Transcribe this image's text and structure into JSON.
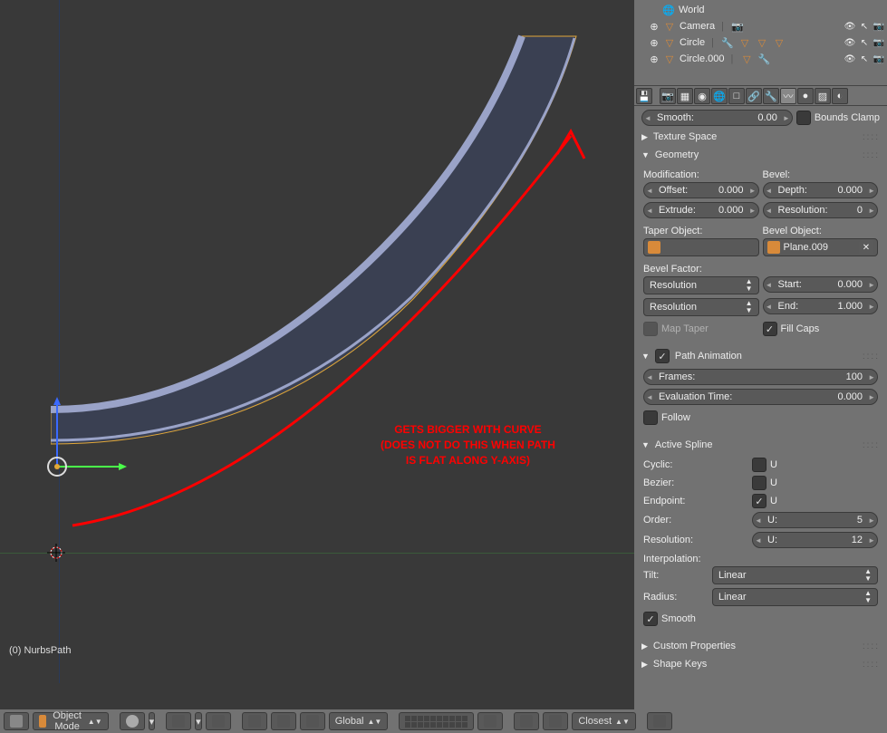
{
  "viewport": {
    "selection_label": "(0)  NurbsPath",
    "annotation_line1": "GETS BIGGER WITH CURVE",
    "annotation_line2": "(DOES NOT DO THIS WHEN PATH",
    "annotation_line3": "IS FLAT ALONG Y-AXIS)"
  },
  "header": {
    "mode": "Object Mode",
    "orientation": "Global",
    "snap_target": "Closest"
  },
  "outliner": {
    "items": [
      {
        "name": "World",
        "icon": "world"
      },
      {
        "name": "Camera",
        "icon": "camera"
      },
      {
        "name": "Circle",
        "icon": "curve"
      },
      {
        "name": "Circle.000",
        "icon": "curve"
      }
    ]
  },
  "smooth_row": {
    "label": "Smooth:",
    "value": "0.00",
    "bounds_clamp": "Bounds Clamp"
  },
  "panels": {
    "texture_space": {
      "title": "Texture Space"
    },
    "geometry": {
      "title": "Geometry",
      "modification_label": "Modification:",
      "bevel_label": "Bevel:",
      "offset_label": "Offset:",
      "offset_value": "0.000",
      "extrude_label": "Extrude:",
      "extrude_value": "0.000",
      "depth_label": "Depth:",
      "depth_value": "0.000",
      "resolution_label": "Resolution:",
      "resolution_value": "0",
      "taper_object_label": "Taper Object:",
      "bevel_object_label": "Bevel Object:",
      "bevel_object_value": "Plane.009",
      "bevel_factor_label": "Bevel Factor:",
      "mapping_start": "Resolution",
      "start_label": "Start:",
      "start_value": "0.000",
      "mapping_end": "Resolution",
      "end_label": "End:",
      "end_value": "1.000",
      "map_taper_label": "Map Taper",
      "fill_caps_label": "Fill Caps"
    },
    "path_animation": {
      "title": "Path Animation",
      "frames_label": "Frames:",
      "frames_value": "100",
      "eval_time_label": "Evaluation Time:",
      "eval_time_value": "0.000",
      "follow_label": "Follow"
    },
    "active_spline": {
      "title": "Active Spline",
      "cyclic_label": "Cyclic:",
      "cyclic_u": "U",
      "bezier_label": "Bezier:",
      "bezier_u": "U",
      "endpoint_label": "Endpoint:",
      "endpoint_u": "U",
      "order_label": "Order:",
      "order_u_label": "U:",
      "order_u_value": "5",
      "reso_label": "Resolution:",
      "reso_u_label": "U:",
      "reso_u_value": "12",
      "interp_label": "Interpolation:",
      "tilt_label": "Tilt:",
      "tilt_value": "Linear",
      "radius_label": "Radius:",
      "radius_value": "Linear",
      "smooth_label": "Smooth"
    },
    "custom_props": {
      "title": "Custom Properties"
    },
    "shape_keys": {
      "title": "Shape Keys"
    }
  }
}
